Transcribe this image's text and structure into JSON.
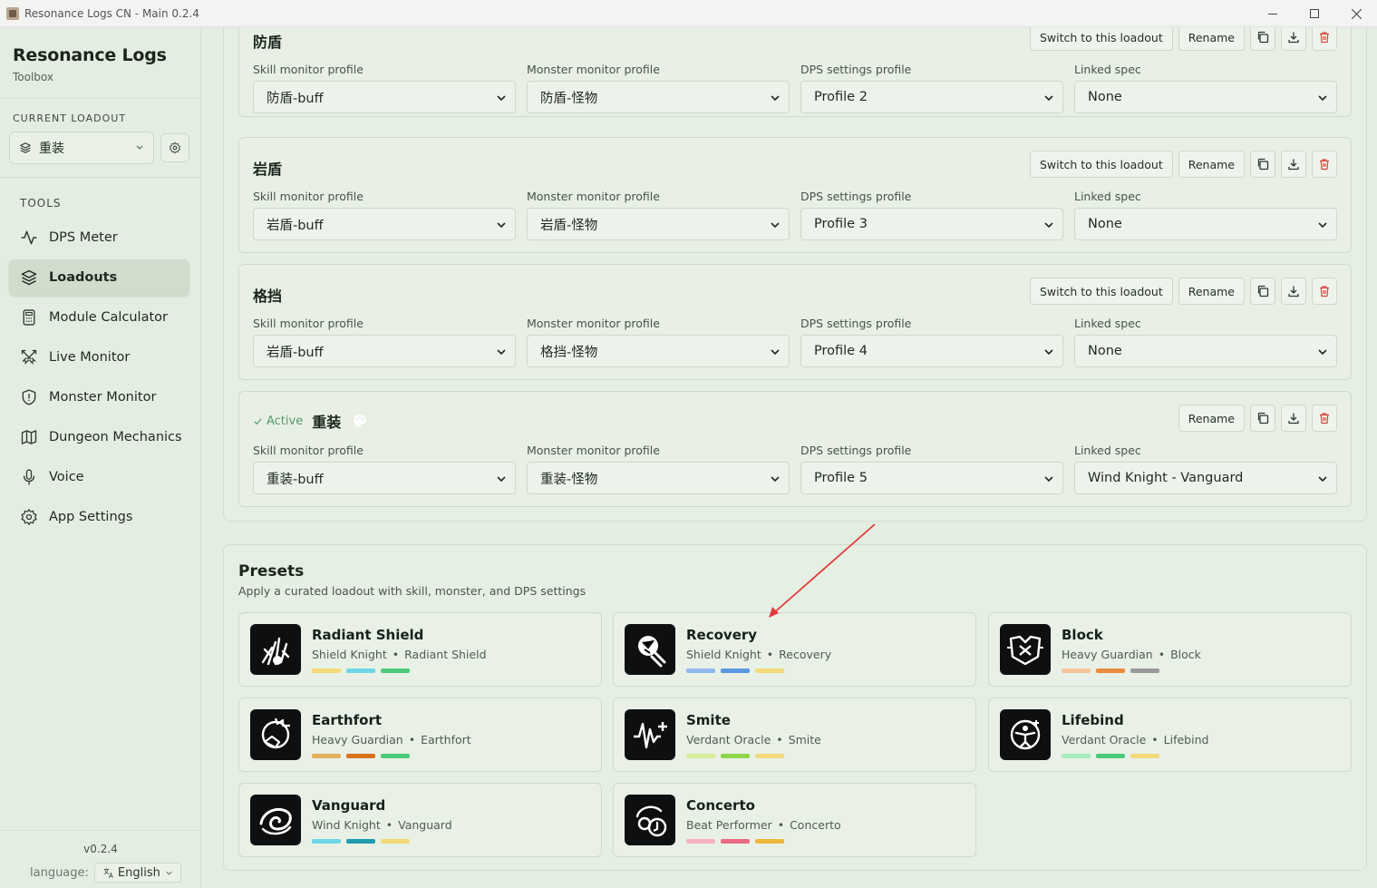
{
  "window": {
    "title": "Resonance Logs CN - Main 0.2.4"
  },
  "sidebar": {
    "app_name": "Resonance Logs",
    "app_sub": "Toolbox",
    "current_loadout_label": "CURRENT LOADOUT",
    "current_loadout_value": "重装",
    "tools_label": "TOOLS",
    "items": [
      {
        "label": "DPS Meter",
        "icon": "activity-icon"
      },
      {
        "label": "Loadouts",
        "icon": "layers-icon",
        "active": true
      },
      {
        "label": "Module Calculator",
        "icon": "calculator-icon"
      },
      {
        "label": "Live Monitor",
        "icon": "swords-icon"
      },
      {
        "label": "Monster Monitor",
        "icon": "shield-icon"
      },
      {
        "label": "Dungeon Mechanics",
        "icon": "map-icon"
      },
      {
        "label": "Voice",
        "icon": "mic-icon"
      },
      {
        "label": "App Settings",
        "icon": "gear-icon"
      }
    ],
    "version": "v0.2.4",
    "language_label": "language:",
    "language_value": "English"
  },
  "field_labels": {
    "skill": "Skill monitor profile",
    "monster": "Monster monitor profile",
    "dps": "DPS settings profile",
    "spec": "Linked spec"
  },
  "buttons": {
    "switch": "Switch to this loadout",
    "rename": "Rename"
  },
  "loadouts": [
    {
      "name": "防盾",
      "skill": "防盾-buff",
      "monster": "防盾-怪物",
      "dps": "Profile 2",
      "spec": "None"
    },
    {
      "name": "岩盾",
      "skill": "岩盾-buff",
      "monster": "岩盾-怪物",
      "dps": "Profile 3",
      "spec": "None"
    },
    {
      "name": "格挡",
      "skill": "岩盾-buff",
      "monster": "格挡-怪物",
      "dps": "Profile 4",
      "spec": "None"
    },
    {
      "name": "重装",
      "active_label": "Active",
      "skill": "重装-buff",
      "monster": "重装-怪物",
      "dps": "Profile 5",
      "spec": "Wind Knight - Vanguard"
    }
  ],
  "presets": {
    "title": "Presets",
    "subtitle": "Apply a curated loadout with skill, monster, and DPS settings",
    "items": [
      {
        "name": "Radiant Shield",
        "class": "Shield Knight",
        "spec": "Radiant Shield",
        "bars": [
          "#f2d97a",
          "#6fd6e4",
          "#4cc97a"
        ]
      },
      {
        "name": "Recovery",
        "class": "Shield Knight",
        "spec": "Recovery",
        "bars": [
          "#8fb8ee",
          "#5b96e0",
          "#f2d97a"
        ]
      },
      {
        "name": "Block",
        "class": "Heavy Guardian",
        "spec": "Block",
        "bars": [
          "#f4c49a",
          "#e98a3c",
          "#9a9a9a"
        ]
      },
      {
        "name": "Earthfort",
        "class": "Heavy Guardian",
        "spec": "Earthfort",
        "bars": [
          "#e2b15c",
          "#d8731a",
          "#4cc97a"
        ]
      },
      {
        "name": "Smite",
        "class": "Verdant Oracle",
        "spec": "Smite",
        "bars": [
          "#d7ec97",
          "#8fd64a",
          "#f2d97a"
        ]
      },
      {
        "name": "Lifebind",
        "class": "Verdant Oracle",
        "spec": "Lifebind",
        "bars": [
          "#a8ecc0",
          "#4cc97a",
          "#f2d97a"
        ]
      },
      {
        "name": "Vanguard",
        "class": "Wind Knight",
        "spec": "Vanguard",
        "bars": [
          "#6fd6e4",
          "#1f9bb0",
          "#f2d97a"
        ]
      },
      {
        "name": "Concerto",
        "class": "Beat Performer",
        "spec": "Concerto",
        "bars": [
          "#f3b3c0",
          "#ea6b80",
          "#eeb73c"
        ]
      }
    ]
  },
  "colors": {
    "accent_green": "#5a9a6f",
    "delete_red": "#d8453c",
    "annotation_arrow": "#e03c3c"
  }
}
